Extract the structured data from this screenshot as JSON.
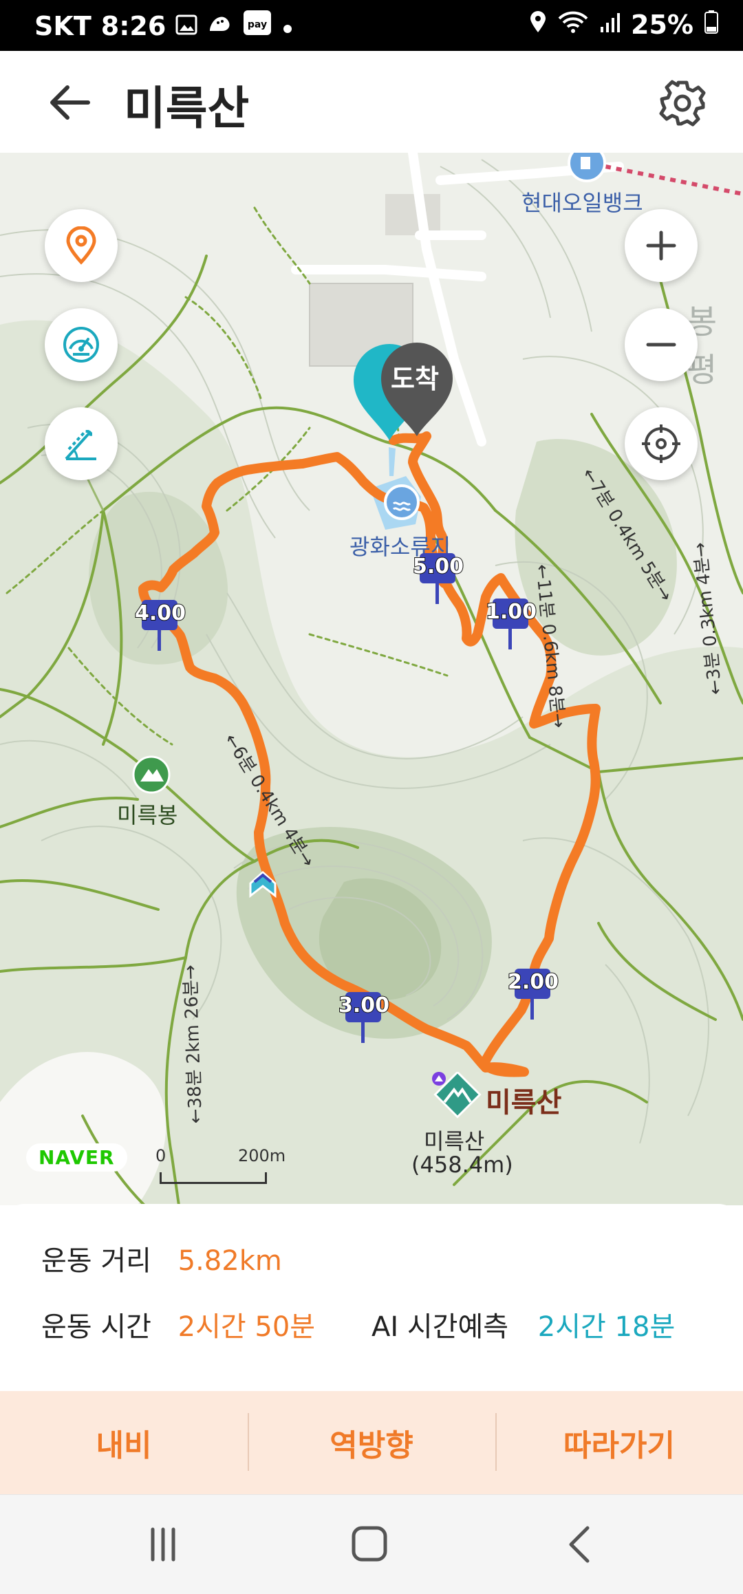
{
  "status_bar": {
    "carrier": "SKT",
    "time": "8:26",
    "battery": "25%",
    "icons": [
      "gallery-icon",
      "shoe-icon",
      "pay-icon",
      "dot-icon",
      "location-icon",
      "wifi-icon",
      "signal-icon",
      "battery-icon"
    ],
    "pay_label": "pay"
  },
  "header": {
    "title": "미륵산",
    "back_icon": "arrow-left-icon",
    "settings_icon": "gear-icon"
  },
  "map": {
    "poi_labels": {
      "gas_station": "현대오일뱅크",
      "reservoir": "광화소류지",
      "left_peak": "미륵봉",
      "main_peak": "미륵산",
      "summit_name": "미륵산",
      "summit_elevation": "(458.4m)",
      "edge_text": "봉평",
      "finish_marker": "도착"
    },
    "route_markers": [
      "1.00",
      "2.00",
      "3.00",
      "4.00",
      "5.00"
    ],
    "trail_labels": [
      "←7분 0.4km 5분→",
      "←11분 0.6km 8분→",
      "←3분 0.3km 4분→",
      "←6분 0.4km 4분→",
      "←38분 2km 26분→"
    ],
    "controls": {
      "left": [
        "location-pin-icon",
        "speedometer-icon",
        "slope-icon"
      ],
      "right": [
        "zoom-in-icon",
        "zoom-out-icon",
        "crosshair-icon"
      ]
    },
    "provider_logo": "NAVER",
    "scale": {
      "start": "0",
      "end": "200m"
    },
    "colors": {
      "route": "#f47b25",
      "trail": "#7fa840",
      "marker": "#3b45b8",
      "teal_pin": "#20b7c7",
      "finish_pin": "#555555"
    }
  },
  "summary": {
    "distance_label": "운동 거리",
    "distance_value": "5.82km",
    "time_label": "운동 시간",
    "time_value": "2시간 50분",
    "ai_label": "AI 시간예측",
    "ai_value": "2시간 18분"
  },
  "actions": {
    "navi": "내비",
    "reverse": "역방향",
    "follow": "따라가기"
  },
  "nav_bar": {
    "icons": [
      "recent-apps-icon",
      "home-icon",
      "back-icon"
    ]
  }
}
